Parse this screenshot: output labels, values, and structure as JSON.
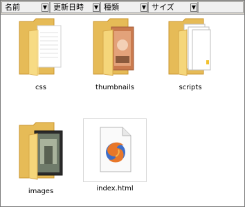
{
  "columns": [
    {
      "label": "名前"
    },
    {
      "label": "更新日時"
    },
    {
      "label": "種類"
    },
    {
      "label": "サイズ"
    }
  ],
  "items": [
    {
      "label": "css",
      "type": "folder-documents"
    },
    {
      "label": "thumbnails",
      "type": "folder-photos"
    },
    {
      "label": "scripts",
      "type": "folder-files"
    },
    {
      "label": "images",
      "type": "folder-images"
    },
    {
      "label": "index.html",
      "type": "firefox-html-document"
    }
  ],
  "colors": {
    "header_bg": "#d4d0c8",
    "folder_front": "#f5d67a",
    "folder_back": "#e6bb57"
  }
}
